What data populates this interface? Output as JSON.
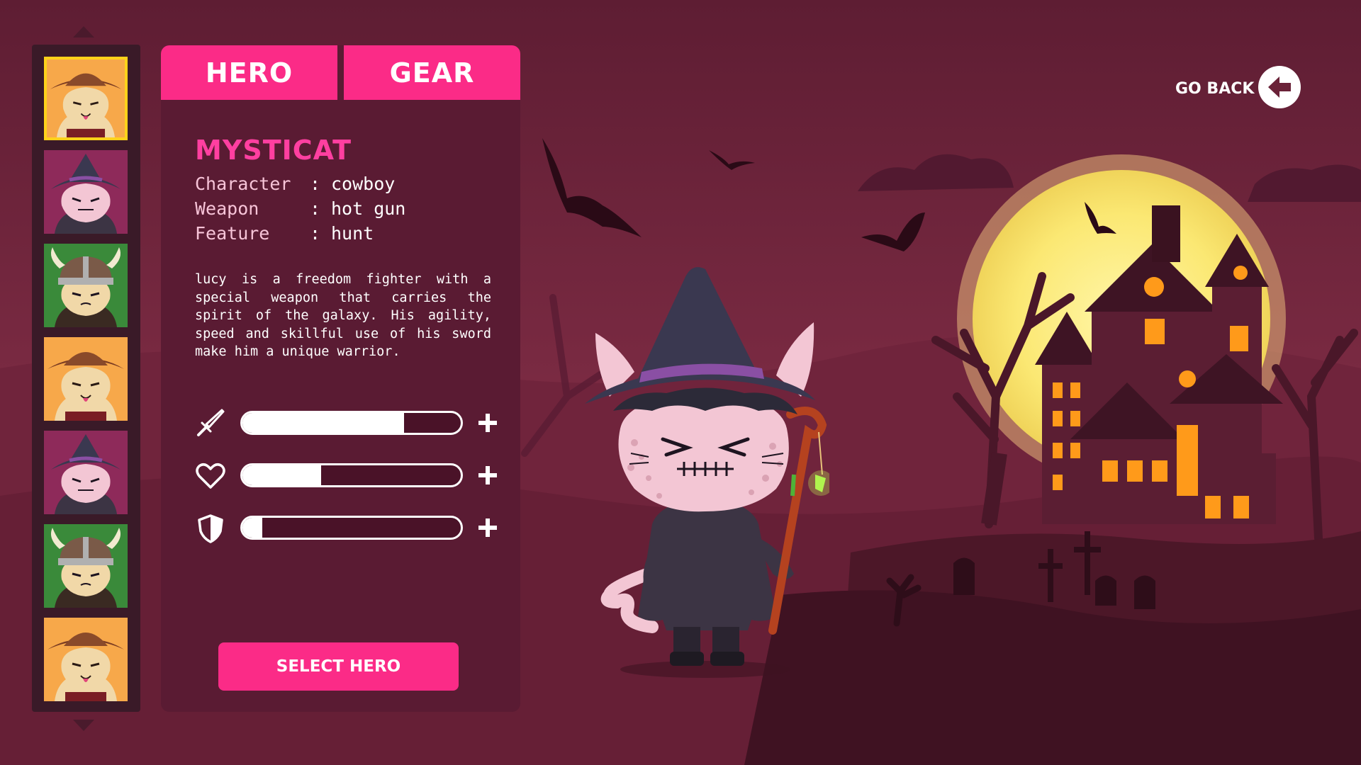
{
  "tabs": {
    "hero_label": "HERO",
    "gear_label": "GEAR"
  },
  "hero": {
    "name": "MYSTICAT",
    "attributes": [
      {
        "label": "Character",
        "value": "cowboy"
      },
      {
        "label": "Weapon",
        "value": "hot gun"
      },
      {
        "label": "Feature",
        "value": "hunt"
      }
    ],
    "description": "lucy is a freedom fighter with a special weapon that carries the spirit of the galaxy. His agility, speed and skillful use of his sword make him a unique warrior."
  },
  "stats": [
    {
      "icon": "sword-icon",
      "level": 0.74
    },
    {
      "icon": "heart-icon",
      "level": 0.36
    },
    {
      "icon": "shield-icon",
      "level": 0.09
    }
  ],
  "select_button": "SELECT HERO",
  "go_back": "GO BACK",
  "roster": [
    {
      "type": "cowboy",
      "selected": true
    },
    {
      "type": "witch",
      "selected": false
    },
    {
      "type": "viking",
      "selected": false
    },
    {
      "type": "cowboy",
      "selected": false
    },
    {
      "type": "witch",
      "selected": false
    },
    {
      "type": "viking",
      "selected": false
    },
    {
      "type": "cowboy",
      "selected": false
    }
  ],
  "colors": {
    "accent": "#fb2b87",
    "name": "#ff3fa0",
    "panel": "#5a1b33",
    "background": "#6a2238",
    "selected_border": "#ffd21a",
    "moon": "#fbe873"
  }
}
